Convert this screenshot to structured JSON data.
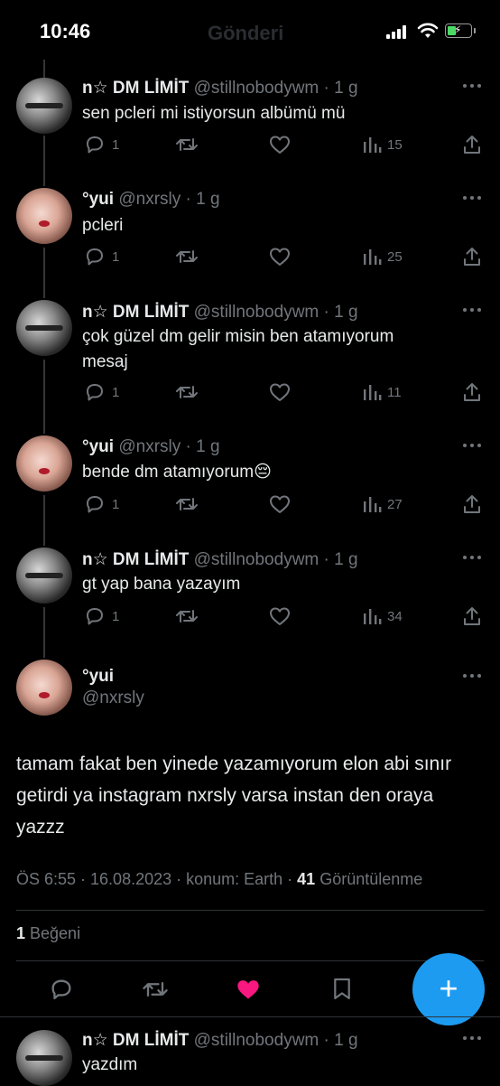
{
  "status_bar": {
    "time": "10:46",
    "header_ghost": "Gönderi"
  },
  "tweets": [
    {
      "name": "n☆ DM LİMİT",
      "meta": "@stillnobodywm · 1 g",
      "text": "sen pcleri mi istiyorsun albümü mü",
      "replies": "1",
      "views": "15",
      "avatar": "dm"
    },
    {
      "name": "°yui",
      "meta": "@nxrsly · 1 g",
      "text": "pcleri",
      "replies": "1",
      "views": "25",
      "avatar": "yui"
    },
    {
      "name": "n☆ DM LİMİT",
      "meta": "@stillnobodywm · 1 g",
      "text": "çok güzel dm gelir misin ben atamıyorum mesaj",
      "replies": "1",
      "views": "11",
      "avatar": "dm"
    },
    {
      "name": "°yui",
      "meta": "@nxrsly · 1 g",
      "text": "bende dm atamıyorum😔",
      "replies": "1",
      "views": "27",
      "avatar": "yui"
    },
    {
      "name": "n☆ DM LİMİT",
      "meta": "@stillnobodywm · 1 g",
      "text": "gt yap bana yazayım",
      "replies": "1",
      "views": "34",
      "avatar": "dm"
    }
  ],
  "main_tweet": {
    "name": "°yui",
    "handle": "@nxrsly",
    "text": "tamam fakat ben yinede yazamıyorum elon abi sınır getirdi ya instagram nxrsly varsa instan den oraya yazzz",
    "timestamp": "ÖS 6:55 · 16.08.2023 · konum: Earth · ",
    "views_count": "41",
    "views_label": " Görüntülenme",
    "likes_count": "1",
    "likes_label": " Beğeni"
  },
  "reply_tweet": {
    "name": "n☆ DM LİMİT",
    "meta": "@stillnobodywm · 1 g",
    "text": "yazdım",
    "avatar": "dm"
  },
  "colors": {
    "background": "#000000",
    "text": "#e7e9ea",
    "muted": "#71767b",
    "accent": "#1d9bf0",
    "like": "#f91880"
  },
  "icons": {
    "reply": "reply-icon",
    "retweet": "retweet-icon",
    "like": "heart-icon",
    "views": "views-icon",
    "share": "share-icon",
    "bookmark": "bookmark-icon",
    "compose": "plus-icon"
  }
}
